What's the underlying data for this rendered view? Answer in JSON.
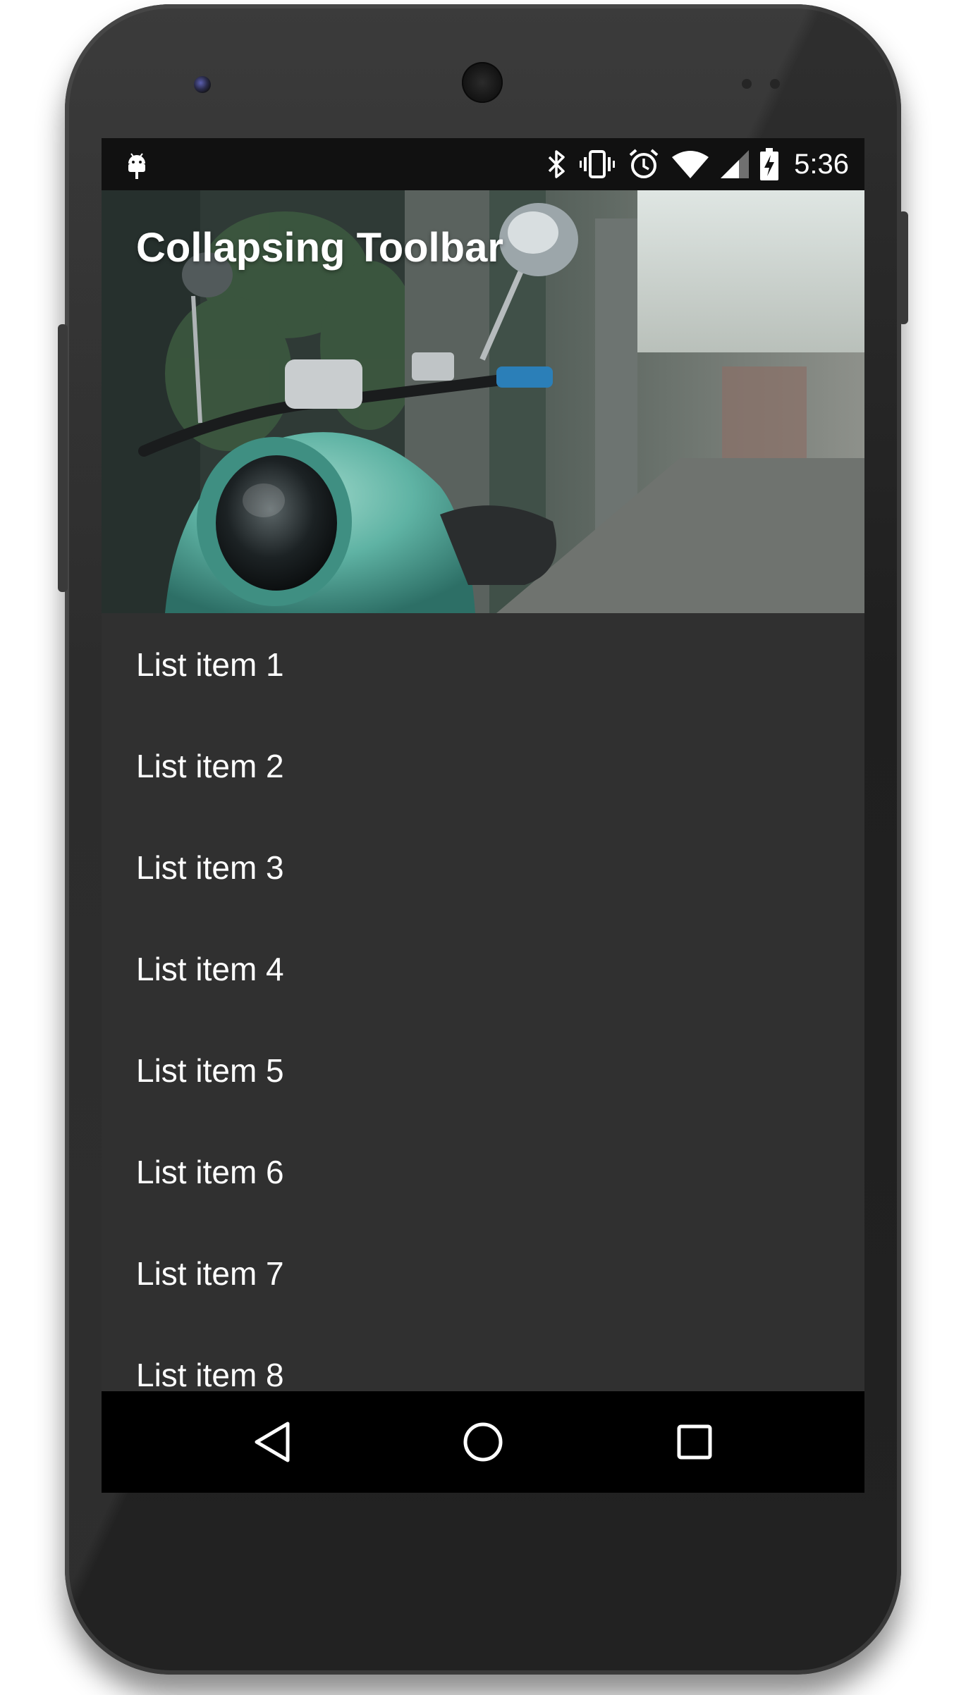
{
  "status_bar": {
    "time": "5:36",
    "icons": [
      "android-debug-icon",
      "bluetooth-icon",
      "vibrate-icon",
      "alarm-icon",
      "wifi-icon",
      "signal-icon",
      "battery-charging-icon"
    ]
  },
  "toolbar": {
    "title": "Collapsing Toolbar",
    "header_image": "scooter-photo"
  },
  "list": {
    "items": [
      {
        "label": "List item 1"
      },
      {
        "label": "List item 2"
      },
      {
        "label": "List item 3"
      },
      {
        "label": "List item 4"
      },
      {
        "label": "List item 5"
      },
      {
        "label": "List item 6"
      },
      {
        "label": "List item 7"
      },
      {
        "label": "List item 8"
      }
    ]
  },
  "nav_bar": {
    "icons": [
      "back-icon",
      "home-icon",
      "recents-icon"
    ]
  },
  "colors": {
    "background": "#303030",
    "status_bar": "#111111",
    "nav_bar": "#000000",
    "text": "#ffffff",
    "scooter_accent": "#5fb3a4"
  }
}
